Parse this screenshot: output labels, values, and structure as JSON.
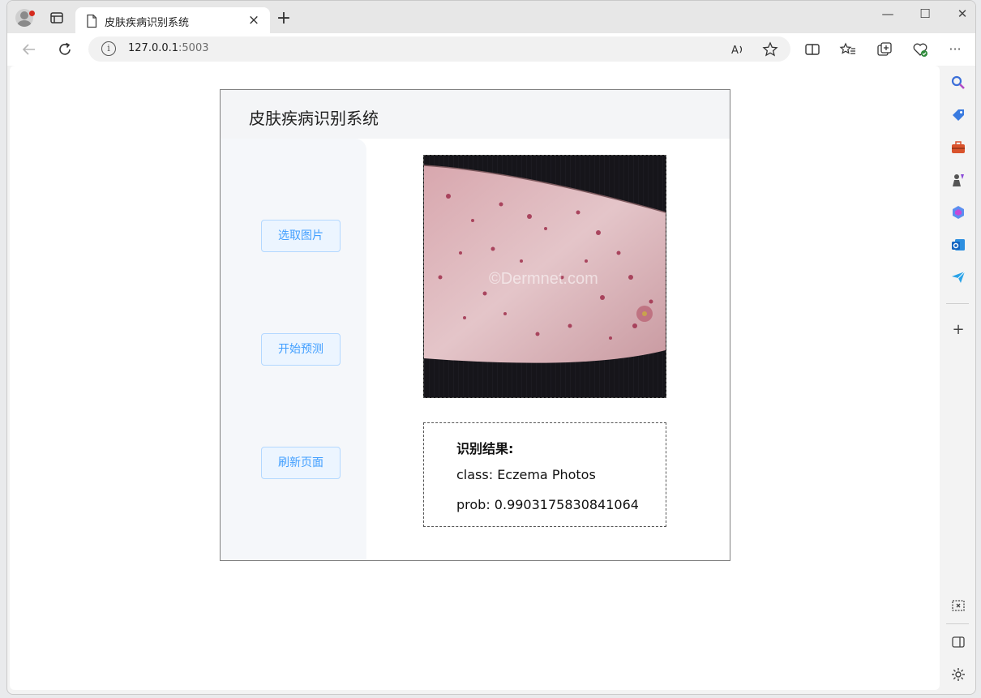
{
  "browser": {
    "tab_title": "皮肤疾病识别系统",
    "tab_close": "×",
    "new_tab": "+",
    "url_host": "127.0.0.1",
    "url_port": ":5003",
    "window_controls": [
      "—",
      "☐",
      "✕"
    ]
  },
  "app": {
    "title": "皮肤疾病识别系统",
    "buttons": {
      "select_image": "选取图片",
      "start_predict": "开始预测",
      "refresh_page": "刷新页面"
    },
    "image": {
      "watermark": "©Dermnet.com"
    },
    "result": {
      "heading": "识别结果:",
      "class_line": "class: Eczema Photos",
      "prob_line": "prob: 0.9903175830841064"
    }
  },
  "colors": {
    "button_bg": "#ecf5ff",
    "button_border": "#b3d8ff",
    "button_text": "#409eff",
    "sidebar_bg": "#f5f7fa"
  },
  "icons": [
    "profile-icon",
    "tab-actions-icon",
    "page-icon",
    "back-icon",
    "reload-icon",
    "info-icon",
    "read-aloud-icon",
    "favorite-icon",
    "split-screen-icon",
    "favorites-icon",
    "collections-icon",
    "browser-essentials-icon",
    "more-icon",
    "search-icon",
    "shopping-icon",
    "tools-icon",
    "games-icon",
    "copilot-icon",
    "outlook-icon",
    "send-icon",
    "add-icon",
    "screenshot-icon",
    "sidebar-toggle-icon",
    "settings-icon"
  ]
}
